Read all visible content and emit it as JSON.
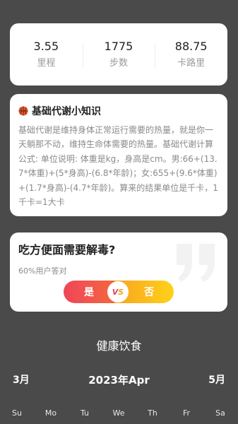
{
  "stats": [
    {
      "value": "3.55",
      "label": "里程"
    },
    {
      "value": "1775",
      "label": "步数"
    },
    {
      "value": "88.75",
      "label": "卡路里"
    }
  ],
  "knowledge": {
    "title": "基础代谢小知识",
    "body": "基础代谢是维持身体正常运行需要的热量，就是你一天躺那不动，维持生命体需要的热量。基础代谢计算公式: 单位说明: 体重是kg，身高是cm。男:66+(13.7*体重)+(5*身高)-(6.8*年龄)；女:655+(9.6*体重)+(1.7*身高)-(4.7*年龄)。算来的结果单位是千卡，1千卡=1大卡"
  },
  "quiz": {
    "question": "吃方便面需要解毒?",
    "stat": "60%用户答对",
    "yes_label": "是",
    "no_label": "否",
    "vs_v": "V",
    "vs_s": "S"
  },
  "section_title": "健康饮食",
  "calendar": {
    "prev_label": "3月",
    "current_label": "2023年Apr",
    "next_label": "5月",
    "weekdays": [
      "Su",
      "Mo",
      "Tu",
      "We",
      "Th",
      "Fr",
      "Sa"
    ]
  },
  "colors": {
    "background": "#4a4a4a",
    "yes_gradient_start": "#f0455a",
    "no_gradient_end": "#ffd21a"
  },
  "icons": {
    "knowledge_icon": "basketball-icon",
    "quote_icon": "quote-icon"
  }
}
